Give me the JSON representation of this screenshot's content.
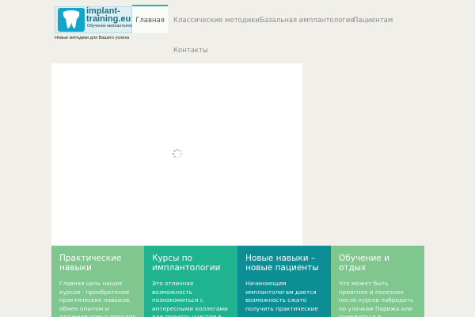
{
  "logo": {
    "name_line1": "implant-",
    "name_line2": "training.eu",
    "subtitle": "Обучение имплантологии",
    "tagline": "Новые методики для Вашего успеха"
  },
  "nav": {
    "home": "Главная",
    "classic": "Классические методики",
    "basal": "Базальная имплантология",
    "patients": "Пациентам",
    "contacts": "Контакты"
  },
  "features": [
    {
      "title": "Практические навыки",
      "text": "Главная цель наших курсов - приобретение практических навыков, обмен опытом и изучение новых методик"
    },
    {
      "title": "Курсы по имплантологии",
      "text": "Это отличная возможность познакомиться с интересными коллегами или принять участие в"
    },
    {
      "title": "Новые навыки – новые пациенты",
      "text": "Начинающим имплантологам дается возможность сжато получить практические"
    },
    {
      "title": "Обучение и отдых",
      "text": "Что может быть приятнее и полезнее после курсов побродить по улочкам Парижа или понежиться в"
    }
  ],
  "colors": {
    "page_bg": "#f0efea",
    "accent_green": "#7fc78e",
    "accent_teal": "#1fb38f",
    "accent_dark_teal": "#0d8d94",
    "nav_active_border": "#1fb89a"
  }
}
